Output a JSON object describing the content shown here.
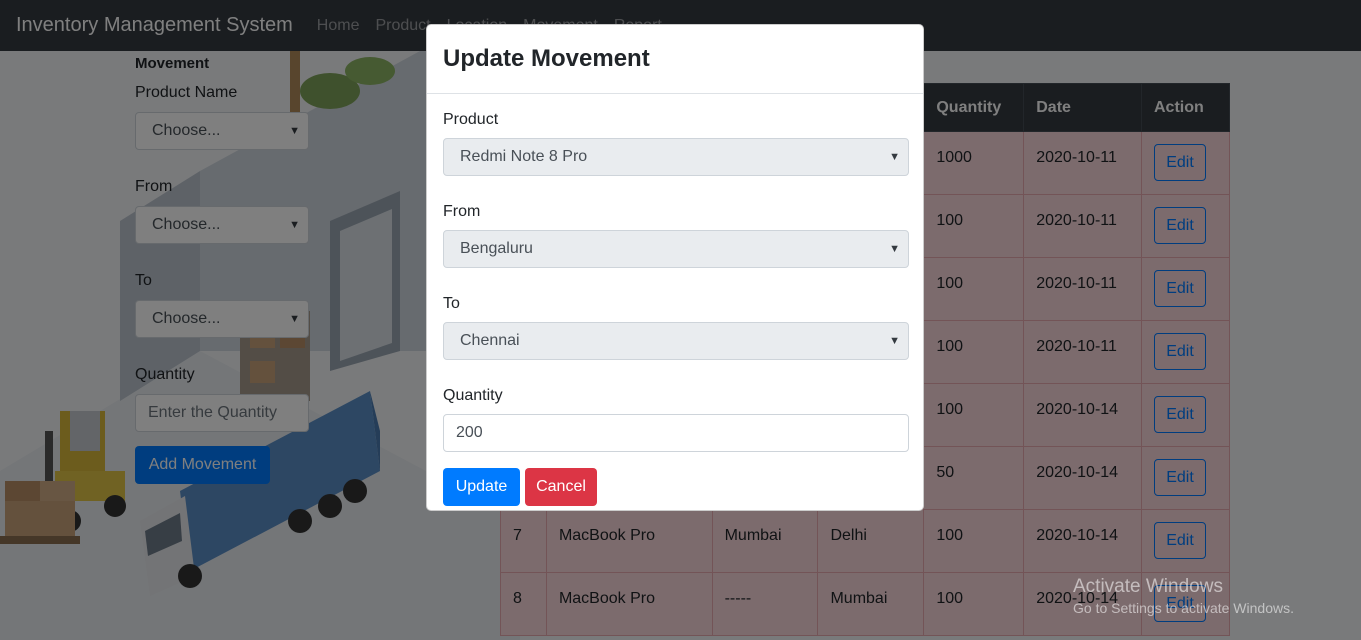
{
  "navbar": {
    "brand": "Inventory Management System",
    "links": [
      "Home",
      "Product",
      "Location",
      "Movement",
      "Report"
    ]
  },
  "left_form": {
    "heading": "Movement",
    "product_label": "Product Name",
    "product_value": "Choose...",
    "from_label": "From",
    "from_value": "Choose...",
    "to_label": "To",
    "to_value": "Choose...",
    "quantity_label": "Quantity",
    "quantity_placeholder": "Enter the Quantity",
    "add_button": "Add Movement"
  },
  "table": {
    "visible_headers": {
      "quantity": "Quantity",
      "date": "Date",
      "action": "Action"
    },
    "rows": [
      {
        "id": "",
        "product": "",
        "from": "",
        "to": "",
        "quantity": "1000",
        "date": "2020-10-11",
        "action": "Edit"
      },
      {
        "id": "",
        "product": "",
        "from": "",
        "to": "",
        "quantity": "100",
        "date": "2020-10-11",
        "action": "Edit"
      },
      {
        "id": "",
        "product": "",
        "from": "",
        "to": "",
        "quantity": "100",
        "date": "2020-10-11",
        "action": "Edit"
      },
      {
        "id": "",
        "product": "",
        "from": "",
        "to": "",
        "quantity": "100",
        "date": "2020-10-11",
        "action": "Edit"
      },
      {
        "id": "",
        "product": "",
        "from": "",
        "to": "",
        "quantity": "100",
        "date": "2020-10-14",
        "action": "Edit"
      },
      {
        "id": "",
        "product": "",
        "from": "",
        "to": "",
        "quantity": "50",
        "date": "2020-10-14",
        "action": "Edit"
      },
      {
        "id": "7",
        "product": "MacBook Pro",
        "from": "Mumbai",
        "to": "Delhi",
        "quantity": "100",
        "date": "2020-10-14",
        "action": "Edit"
      },
      {
        "id": "8",
        "product": "MacBook Pro",
        "from": "-----",
        "to": "Mumbai",
        "quantity": "100",
        "date": "2020-10-14",
        "action": "Edit"
      }
    ]
  },
  "modal": {
    "title": "Update Movement",
    "product_label": "Product",
    "product_value": "Redmi Note 8 Pro",
    "from_label": "From",
    "from_value": "Bengaluru",
    "to_label": "To",
    "to_value": "Chennai",
    "quantity_label": "Quantity",
    "quantity_value": "200",
    "update_button": "Update",
    "cancel_button": "Cancel"
  },
  "watermark": {
    "title": "Activate Windows",
    "subtitle": "Go to Settings to activate Windows."
  },
  "colors": {
    "navbar": "#343a40",
    "primary": "#007bff",
    "danger": "#dc3545",
    "row_danger": "#f8d7da"
  }
}
